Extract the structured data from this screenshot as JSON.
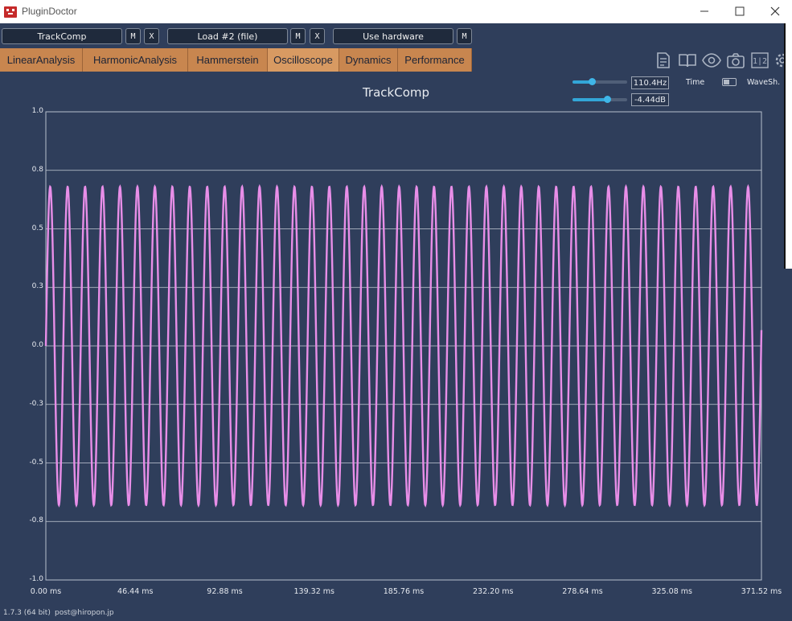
{
  "window": {
    "title": "PluginDoctor"
  },
  "controls": {
    "plugin_a": "TrackComp",
    "plugin_b": "Load #2 (file)",
    "hardware": "Use hardware",
    "m_label": "M",
    "x_label": "X"
  },
  "tabs": [
    "LinearAnalysis",
    "HarmonicAnalysis",
    "Hammerstein",
    "Oscilloscope",
    "Dynamics",
    "Performance"
  ],
  "active_tab": "Oscilloscope",
  "toolbar_icons": [
    "notes-icon",
    "book-icon",
    "eye-icon",
    "camera-icon",
    "channel-split-icon",
    "settings-icon"
  ],
  "toolbar_channel_label": "1|2",
  "params": {
    "frequency": "110.4Hz",
    "gain": "-4.44dB",
    "frequency_level": 0.35,
    "gain_level": 0.63,
    "time_label": "Time",
    "waveshape_label": "WaveSh."
  },
  "chart_data": {
    "type": "line",
    "title": "TrackComp",
    "xlabel": "",
    "ylabel": "",
    "x_unit": "ms",
    "xlim": [
      0,
      371.52
    ],
    "ylim": [
      -1.0,
      1.0
    ],
    "yticks": [
      "1.0",
      "0.8",
      "0.5",
      "0.3",
      "0.0",
      "-0.3",
      "-0.5",
      "-0.8",
      "-1.0"
    ],
    "xticks": [
      "0.00 ms",
      "46.44 ms",
      "92.88 ms",
      "139.32 ms",
      "185.76 ms",
      "232.20 ms",
      "278.64 ms",
      "325.08 ms",
      "371.52 ms"
    ],
    "grid": true,
    "series": [
      {
        "waveform": "sine",
        "frequency_hz": 110.4,
        "amplitude": 0.68,
        "color": "#e88ee8"
      }
    ]
  },
  "footer": {
    "version": "1.7.3 (64 bit)",
    "email": "post@hiropon.jp"
  },
  "colors": {
    "background": "#2f3e5b",
    "tab": "#c8864f",
    "waveform": "#e88ee8",
    "slider_accent": "#33a6d8"
  }
}
